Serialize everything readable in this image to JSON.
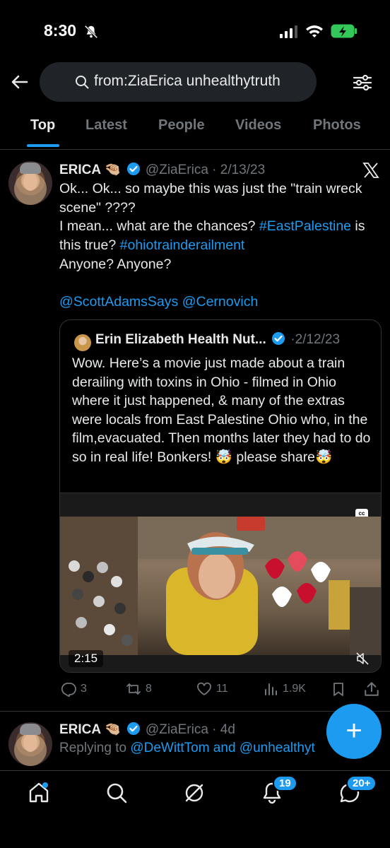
{
  "status_bar": {
    "time": "8:30"
  },
  "search": {
    "query": "from:ZiaErica unhealthytruth"
  },
  "tabs": [
    {
      "label": "Top",
      "active": true
    },
    {
      "label": "Latest"
    },
    {
      "label": "People"
    },
    {
      "label": "Videos"
    },
    {
      "label": "Photos"
    }
  ],
  "tweet": {
    "name": "ERICA 🤏🏼",
    "handle": "@ZiaErica",
    "date": "2/13/23",
    "line1": "Ok... Ok... so maybe this was just the \"train wreck scene\" ????",
    "line2_a": "I mean... what are the chances? ",
    "line2_tag": "#EastPalestine",
    "line2_b": " is this true? ",
    "line2_tag2": "#ohiotrainderailment",
    "line3": "Anyone? Anyone?",
    "mention1": "@ScottAdamsSays",
    "mention2": "@Cernovich",
    "quote": {
      "name": "Erin Elizabeth Health Nut...",
      "date": "2/12/23",
      "text": "Wow. Here’s a movie just made about a train derailing with toxins in Ohio - filmed in Ohio where it just happened, &  many of the extras were locals from East Palestine Ohio who, in the film,evacuated. Then months later they had to do so in real life! Bonkers! 🤯 please share🤯",
      "video_duration": "2:15",
      "cc_label": "cc"
    },
    "counts": {
      "replies": "3",
      "reposts": "8",
      "likes": "11",
      "views": "1.9K"
    }
  },
  "reply_tweet": {
    "name": "ERICA 🤏🏼",
    "handle": "@ZiaErica",
    "date": "4d",
    "replying_prefix": "Replying to ",
    "replying_to": "@DeWittTom and @unhealthyt"
  },
  "bottom_nav": {
    "notifications_badge": "19",
    "messages_badge": "20+"
  },
  "fab_label": "+",
  "colors": {
    "accent": "#1d9bf0",
    "background": "#000000",
    "muted": "#71767b"
  }
}
